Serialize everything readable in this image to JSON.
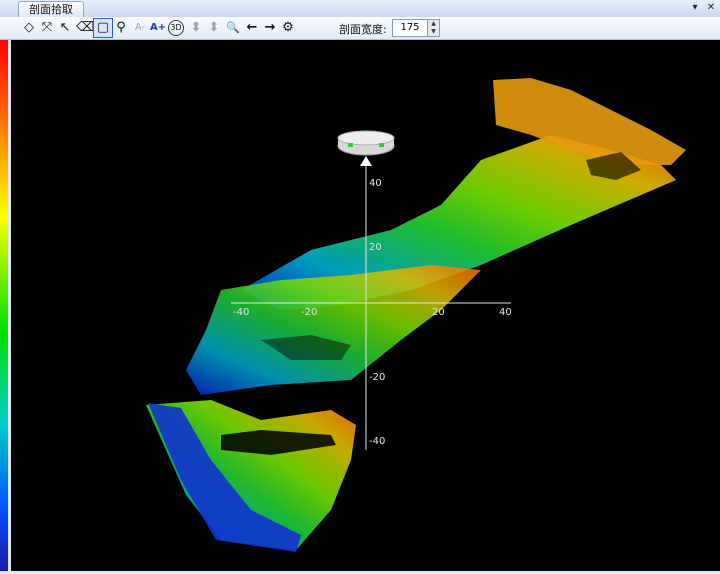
{
  "window": {
    "tab_title": "剖面拾取",
    "dropdown_icon": "▾",
    "close_icon": "✕"
  },
  "toolbar": {
    "tools": [
      {
        "name": "rotate-tool",
        "glyph": "◇"
      },
      {
        "name": "fit-extent-tool",
        "glyph": "⤧"
      },
      {
        "name": "select-pointer-tool",
        "glyph": "↖"
      },
      {
        "name": "eraser-tool",
        "glyph": "⌫"
      },
      {
        "name": "rect-select-tool",
        "glyph": "▢"
      },
      {
        "name": "lasso-zoom-tool",
        "glyph": "⚲"
      },
      {
        "name": "font-decrease-tool",
        "glyph": "A-"
      },
      {
        "name": "font-increase-tool",
        "glyph": "A+"
      },
      {
        "name": "view-3d-tool",
        "glyph": "3D"
      },
      {
        "name": "fit-height-tool",
        "glyph": "⬍"
      },
      {
        "name": "fit-height-alt-tool",
        "glyph": "⬍"
      },
      {
        "name": "magnifier-tool",
        "glyph": "🔍"
      },
      {
        "name": "previous-tool",
        "glyph": "←"
      },
      {
        "name": "next-tool",
        "glyph": "→"
      },
      {
        "name": "settings-tool",
        "glyph": "⚙"
      }
    ],
    "width_label": "剖面宽度:",
    "width_value": "175"
  },
  "view": {
    "colors": [
      "#ff0000",
      "#ffff00",
      "#00dd00",
      "#00cccc",
      "#0044ff"
    ],
    "x_ticks": [
      "-40",
      "-20",
      "20",
      "40"
    ],
    "y_ticks": [
      "40",
      "20",
      "-20",
      "-40"
    ]
  }
}
